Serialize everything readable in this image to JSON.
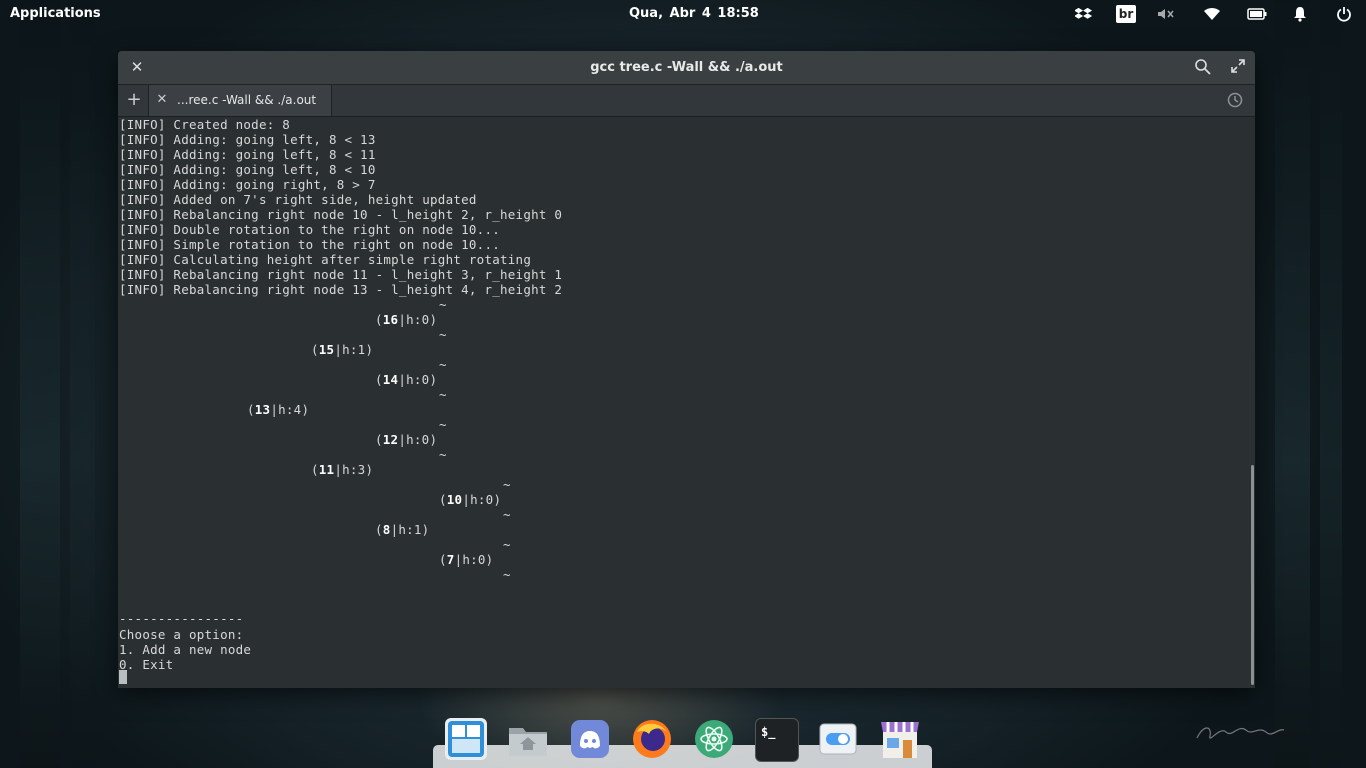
{
  "panel": {
    "applications_label": "Applications",
    "clock": "Qua, Abr  4    18:58",
    "keyboard_layout": "br",
    "indicators": [
      "dropbox-icon",
      "keyboard-layout-indicator",
      "volume-muted-icon",
      "wifi-icon",
      "battery-icon",
      "notifications-bell-icon",
      "power-icon"
    ]
  },
  "window": {
    "title": "gcc tree.c -Wall && ./a.out",
    "tab_label": "...ree.c -Wall && ./a.out"
  },
  "terminal": {
    "log_lines": [
      "[INFO] Created node: 8",
      "[INFO] Adding: going left, 8 < 13",
      "[INFO] Adding: going left, 8 < 11",
      "[INFO] Adding: going left, 8 < 10",
      "[INFO] Adding: going right, 8 > 7",
      "[INFO] Added on 7's right side, height updated",
      "[INFO] Rebalancing right node 10 - l_height 2, r_height 0",
      "[INFO] Double rotation to the right on node 10...",
      "[INFO] Simple rotation to the right on node 10...",
      "[INFO] Calculating height after simple right rotating",
      "[INFO] Rebalancing right node 11 - l_height 3, r_height 1",
      "[INFO] Rebalancing right node 13 - l_height 4, r_height 2"
    ],
    "tree_nodes": [
      {
        "key": "16",
        "height": "|h:0)"
      },
      {
        "key": "15",
        "height": "|h:1)"
      },
      {
        "key": "14",
        "height": "|h:0)"
      },
      {
        "key": "13",
        "height": "|h:4)"
      },
      {
        "key": "12",
        "height": "|h:0)"
      },
      {
        "key": "11",
        "height": "|h:3)"
      },
      {
        "key": "10",
        "height": "|h:0)"
      },
      {
        "key": "8",
        "height": "|h:1)"
      },
      {
        "key": "7",
        "height": "|h:0)"
      }
    ],
    "null_marker": "~",
    "open_paren": "(",
    "separator": "----------------",
    "menu_prompt": "Choose a option:",
    "menu_items": [
      "1. Add a new node",
      "0. Exit"
    ]
  },
  "dock": {
    "apps": [
      "windows-tiles-icon",
      "files-icon",
      "discord-icon",
      "firefox-icon",
      "atom-icon",
      "terminal-icon",
      "switchboard-settings-icon",
      "appcenter-icon"
    ],
    "terminal_icon_text": "$_"
  },
  "colors": {
    "terminal_bg": "#2a2f31",
    "terminal_fg": "#d8d8d8",
    "titlebar": "#3a3f41"
  }
}
